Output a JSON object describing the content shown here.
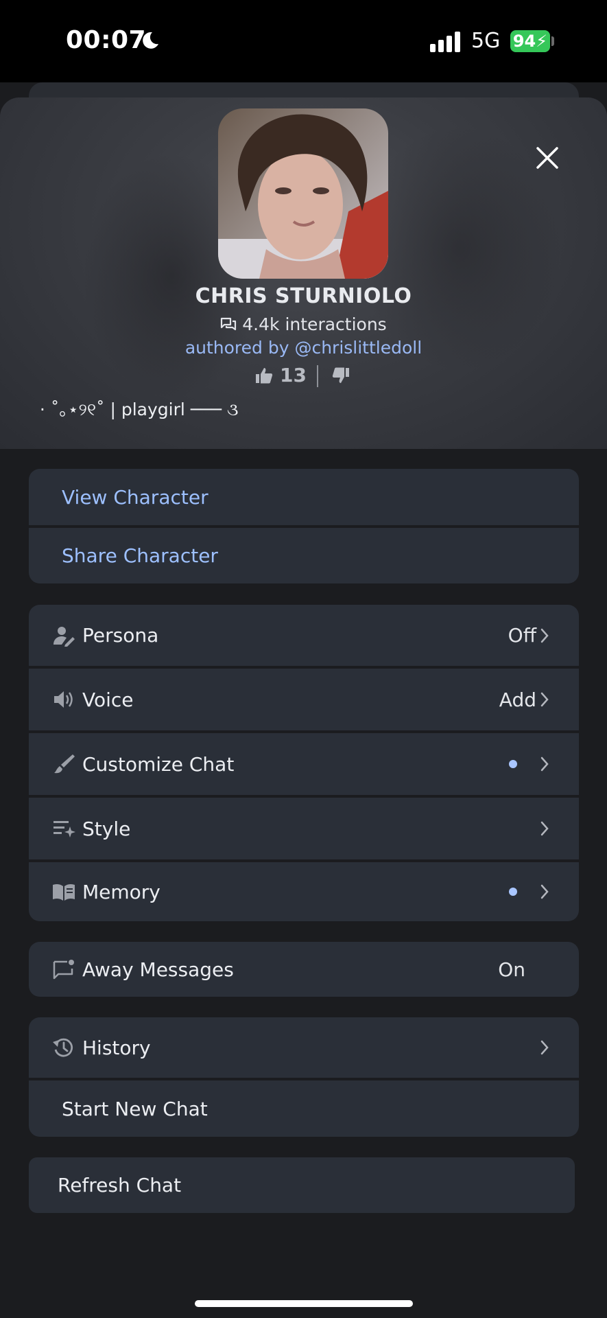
{
  "status_bar": {
    "time": "00:07",
    "network": "5G",
    "battery": "94"
  },
  "profile": {
    "name": "CHRIS STURNIOLO",
    "interactions": "4.4k interactions",
    "author": "authored by @chrislittledoll",
    "likes": "13",
    "tagline": "⋅ ˚｡⋆୨୧˚ | playgirl ─── ૩"
  },
  "actions": {
    "view_character": "View Character",
    "share_character": "Share Character"
  },
  "settings": {
    "persona": {
      "label": "Persona",
      "value": "Off"
    },
    "voice": {
      "label": "Voice",
      "value": "Add"
    },
    "customize_chat": {
      "label": "Customize Chat"
    },
    "style": {
      "label": "Style"
    },
    "memory": {
      "label": "Memory"
    }
  },
  "away_messages": {
    "label": "Away Messages",
    "value": "On"
  },
  "chat": {
    "history": "History",
    "start_new_chat": "Start New Chat",
    "refresh_chat": "Refresh Chat"
  },
  "colors": {
    "accent": "#9dc0ff",
    "card": "#2a2f38",
    "background": "#1b1c1f"
  }
}
